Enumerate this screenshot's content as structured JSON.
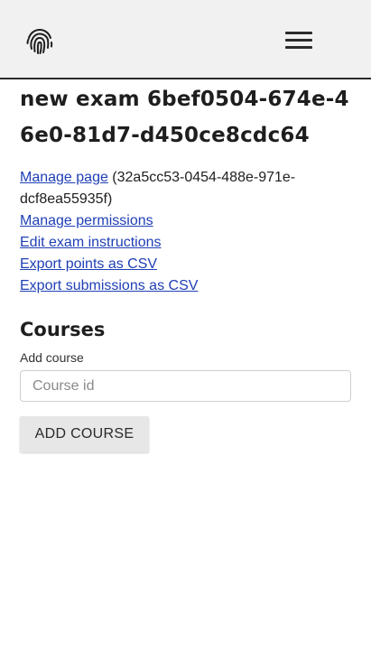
{
  "header": {
    "logo_icon": "fingerprint-icon",
    "menu_icon": "hamburger-menu-icon"
  },
  "main": {
    "title": "new exam 6bef0504-674e-46e0-81d7-d450ce8cdc64",
    "links": {
      "manage_page": "Manage page",
      "page_id": " (32a5cc53-0454-488e-971e-dcf8ea55935f)",
      "manage_permissions": "Manage permissions",
      "edit_instructions": "Edit exam instructions",
      "export_points": "Export points as CSV",
      "export_submissions": "Export submissions as CSV"
    },
    "courses": {
      "heading": "Courses",
      "add_label": "Add course",
      "input_placeholder": "Course id",
      "input_value": "",
      "add_button": "ADD COURSE"
    }
  },
  "colors": {
    "topbar_bg": "#f1f1f1",
    "link": "#1f3fb5",
    "button_bg": "#e7e7e7",
    "text": "#202020"
  }
}
